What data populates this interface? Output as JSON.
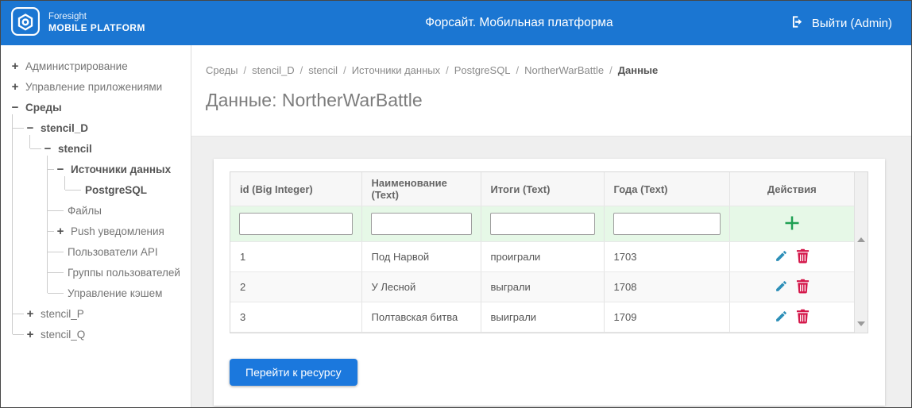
{
  "header": {
    "logo_line1": "Foresight",
    "logo_line2": "MOBILE PLATFORM",
    "title": "Форсайт. Мобильная платформа",
    "logout_label": "Выйти (Admin)"
  },
  "sidebar": {
    "items": [
      {
        "label": "Администрирование",
        "toggle": "+"
      },
      {
        "label": "Управление приложениями",
        "toggle": "+"
      },
      {
        "label": "Среды",
        "toggle": "−"
      },
      {
        "label": "stencil_D",
        "toggle": "−"
      },
      {
        "label": "stencil",
        "toggle": "−"
      },
      {
        "label": "Источники данных",
        "toggle": "−"
      },
      {
        "label": "PostgreSQL",
        "toggle": ""
      },
      {
        "label": "Файлы",
        "toggle": ""
      },
      {
        "label": "Push уведомления",
        "toggle": "+"
      },
      {
        "label": "Пользователи API",
        "toggle": ""
      },
      {
        "label": "Группы пользователей",
        "toggle": ""
      },
      {
        "label": "Управление кэшем",
        "toggle": ""
      },
      {
        "label": "stencil_P",
        "toggle": "+"
      },
      {
        "label": "stencil_Q",
        "toggle": "+"
      }
    ]
  },
  "breadcrumb": {
    "separator": "/",
    "items": [
      "Среды",
      "stencil_D",
      "stencil",
      "Источники данных",
      "PostgreSQL",
      "NortherWarBattle",
      "Данные"
    ]
  },
  "page": {
    "title": "Данные: NortherWarBattle"
  },
  "table": {
    "columns": [
      "id (Big Integer)",
      "Наименование (Text)",
      "Итоги (Text)",
      "Года (Text)",
      "Действия"
    ],
    "rows": [
      {
        "id": "1",
        "name": "Под Нарвой",
        "result": "проиграли",
        "year": "1703"
      },
      {
        "id": "2",
        "name": "У Лесной",
        "result": "выграли",
        "year": "1708"
      },
      {
        "id": "3",
        "name": "Полтавская битва",
        "result": "выиграли",
        "year": "1709"
      }
    ]
  },
  "actions": {
    "go_to_resource": "Перейти к ресурсу"
  },
  "colors": {
    "header_blue": "#1b76d2",
    "button_blue": "#1b78dd",
    "add_green": "#1fa053",
    "edit_blue": "#2d8fb8",
    "delete_red": "#d4174a",
    "filter_row_green": "#e6f8e7"
  }
}
